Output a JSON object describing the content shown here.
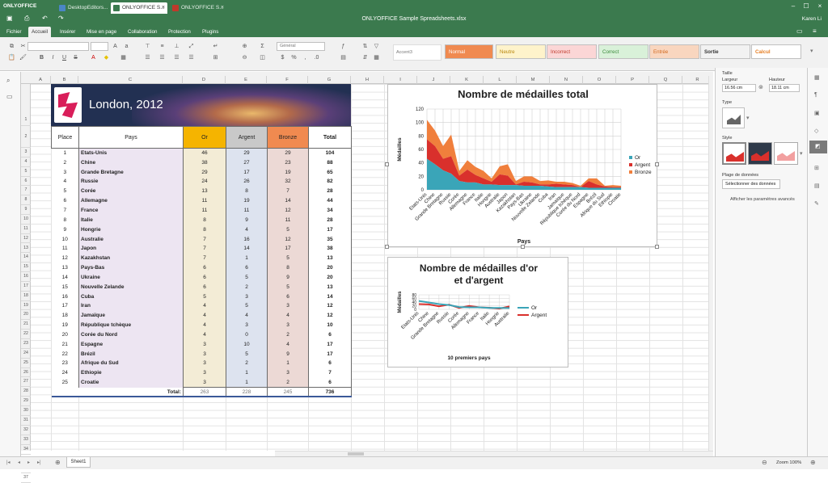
{
  "titlebar": {
    "logo": "ONLYOFFICE",
    "tabs": [
      {
        "label": "DesktopEditors...",
        "color": "#4a86c5"
      },
      {
        "label": "ONLYOFFICE S...",
        "color": "#3b7a4e",
        "active": true
      },
      {
        "label": "ONLYOFFICE S...",
        "color": "#c0392b"
      }
    ],
    "title": "ONLYOFFICE Sample Spreadsheets.xlsx",
    "user": "Karen Li"
  },
  "menu": [
    "Fichier",
    "Accueil",
    "Insérer",
    "Mise en page",
    "Collaboration",
    "Protection",
    "Plugins"
  ],
  "toolbar": {
    "number_format": "Général",
    "cell_style_name": "Accent3",
    "styles": [
      {
        "label": "Normal",
        "bg": "#f08a50",
        "fg": "#ffffff"
      },
      {
        "label": "Neutre",
        "bg": "#fef3cb",
        "fg": "#b8860b"
      },
      {
        "label": "Incorrect",
        "bg": "#fbd6d6",
        "fg": "#c0392b"
      },
      {
        "label": "Correct",
        "bg": "#d9f1d9",
        "fg": "#3a8a3a"
      },
      {
        "label": "Entrée",
        "bg": "#f9d6bf",
        "fg": "#d2691e"
      },
      {
        "label": "Sortie",
        "bg": "#f2f2f2",
        "fg": "#333333"
      },
      {
        "label": "Calcul",
        "bg": "#ffffff",
        "fg": "#e67e22"
      }
    ]
  },
  "columns": [
    "A",
    "B",
    "C",
    "D",
    "E",
    "F",
    "G",
    "H",
    "I",
    "J",
    "K",
    "L",
    "M",
    "N",
    "O",
    "P",
    "Q",
    "R"
  ],
  "rows": [
    "1",
    "2",
    "3",
    "4",
    "5",
    "6",
    "7",
    "8",
    "9",
    "10",
    "11",
    "12",
    "13",
    "14",
    "15",
    "16",
    "17",
    "18",
    "19",
    "20",
    "21",
    "22",
    "23",
    "24",
    "25",
    "26",
    "27",
    "28",
    "29",
    "30",
    "31",
    "32",
    "33",
    "34",
    "35",
    "36",
    "37"
  ],
  "banner_title": "London, 2012",
  "table": {
    "headers": [
      "Place",
      "Pays",
      "Or",
      "Argent",
      "Bronze",
      "Total"
    ],
    "rows": [
      [
        "1",
        "Etats-Unis",
        "46",
        "29",
        "29",
        "104"
      ],
      [
        "2",
        "Chine",
        "38",
        "27",
        "23",
        "88"
      ],
      [
        "3",
        "Grande Bretagne",
        "29",
        "17",
        "19",
        "65"
      ],
      [
        "4",
        "Russie",
        "24",
        "26",
        "32",
        "82"
      ],
      [
        "5",
        "Corée",
        "13",
        "8",
        "7",
        "28"
      ],
      [
        "6",
        "Allemagne",
        "11",
        "19",
        "14",
        "44"
      ],
      [
        "7",
        "France",
        "11",
        "11",
        "12",
        "34"
      ],
      [
        "8",
        "Italie",
        "8",
        "9",
        "11",
        "28"
      ],
      [
        "9",
        "Hongrie",
        "8",
        "4",
        "5",
        "17"
      ],
      [
        "10",
        "Australie",
        "7",
        "16",
        "12",
        "35"
      ],
      [
        "11",
        "Japon",
        "7",
        "14",
        "17",
        "38"
      ],
      [
        "12",
        "Kazakhstan",
        "7",
        "1",
        "5",
        "13"
      ],
      [
        "13",
        "Pays-Bas",
        "6",
        "6",
        "8",
        "20"
      ],
      [
        "14",
        "Ukraine",
        "6",
        "5",
        "9",
        "20"
      ],
      [
        "15",
        "Nouvelle Zelande",
        "6",
        "2",
        "5",
        "13"
      ],
      [
        "16",
        "Cuba",
        "5",
        "3",
        "6",
        "14"
      ],
      [
        "17",
        "Iran",
        "4",
        "5",
        "3",
        "12"
      ],
      [
        "18",
        "Jamaïque",
        "4",
        "4",
        "4",
        "12"
      ],
      [
        "19",
        "République tchèque",
        "4",
        "3",
        "3",
        "10"
      ],
      [
        "20",
        "Corée du Nord",
        "4",
        "0",
        "2",
        "6"
      ],
      [
        "21",
        "Espagne",
        "3",
        "10",
        "4",
        "17"
      ],
      [
        "22",
        "Brézil",
        "3",
        "5",
        "9",
        "17"
      ],
      [
        "23",
        "Afrique du Sud",
        "3",
        "2",
        "1",
        "6"
      ],
      [
        "24",
        "Ethiopie",
        "3",
        "1",
        "3",
        "7"
      ],
      [
        "25",
        "Croatie",
        "3",
        "1",
        "2",
        "6"
      ]
    ],
    "total_label": "Total:",
    "totals": [
      "263",
      "228",
      "245",
      "736"
    ]
  },
  "chart_data": [
    {
      "type": "area",
      "title": "Nombre de médailles total",
      "xlabel": "Pays",
      "ylabel": "Médailles",
      "ylim": [
        0,
        120
      ],
      "yticks": [
        "0",
        "20",
        "40",
        "60",
        "80",
        "100",
        "120"
      ],
      "categories": [
        "Etats-Unis",
        "Chine",
        "Grande Bretagne",
        "Russie",
        "Corée",
        "Allemagne",
        "France",
        "Italie",
        "Hongrie",
        "Australie",
        "Japon",
        "Kazakhstan",
        "Pays-Bas",
        "Ukraine",
        "Nouvelle Zelande",
        "Cuba",
        "Iran",
        "Jamaïque",
        "République tchèque",
        "Corée du Nord",
        "Espagne",
        "Brézil",
        "Afrique du Sud",
        "Ethiopie",
        "Croatie"
      ],
      "stacked": true,
      "legend": "right",
      "series": [
        {
          "name": "Or",
          "color": "#3aa5b8",
          "values": [
            46,
            38,
            29,
            24,
            13,
            11,
            11,
            8,
            8,
            7,
            7,
            7,
            6,
            6,
            6,
            5,
            4,
            4,
            4,
            4,
            3,
            3,
            3,
            3,
            3
          ]
        },
        {
          "name": "Argent",
          "color": "#d9302c",
          "values": [
            29,
            27,
            17,
            26,
            8,
            19,
            11,
            9,
            4,
            16,
            14,
            1,
            6,
            5,
            2,
            3,
            5,
            4,
            3,
            0,
            10,
            5,
            2,
            1,
            1
          ]
        },
        {
          "name": "Bronze",
          "color": "#f07f3c",
          "values": [
            29,
            23,
            19,
            32,
            7,
            14,
            12,
            11,
            5,
            12,
            17,
            5,
            8,
            9,
            5,
            6,
            3,
            4,
            3,
            2,
            4,
            9,
            1,
            3,
            2
          ]
        }
      ]
    },
    {
      "type": "line",
      "title": "Nombre de médailles d'or et d'argent",
      "xlabel": "10 premiers pays",
      "ylabel": "Médailles",
      "ylim": [
        0,
        80
      ],
      "yticks": [
        "0",
        "20",
        "40",
        "60",
        "80"
      ],
      "categories": [
        "Etats-Unis",
        "Chine",
        "Grande Bretagne",
        "Russie",
        "Corée",
        "Allemagne",
        "France",
        "Italie",
        "Hongrie",
        "Australie"
      ],
      "legend": "right",
      "series": [
        {
          "name": "Or",
          "color": "#3aa5b8",
          "values": [
            46,
            38,
            29,
            24,
            13,
            11,
            11,
            8,
            8,
            7
          ]
        },
        {
          "name": "Argent",
          "color": "#d9302c",
          "values": [
            29,
            27,
            17,
            26,
            8,
            19,
            11,
            9,
            4,
            16
          ]
        }
      ]
    }
  ],
  "rightpanel": {
    "taille": "Taille",
    "largeur_label": "Largeur",
    "largeur": "16.56 cm",
    "hauteur_label": "Hauteur",
    "hauteur": "18.11 cm",
    "type": "Type",
    "style": "Style",
    "range": "Plage de données",
    "select_btn": "Sélectionner des données",
    "advanced": "Afficher les paramètres avancés"
  },
  "status": {
    "sheet": "Sheet1",
    "zoom": "Zoom 100%"
  }
}
